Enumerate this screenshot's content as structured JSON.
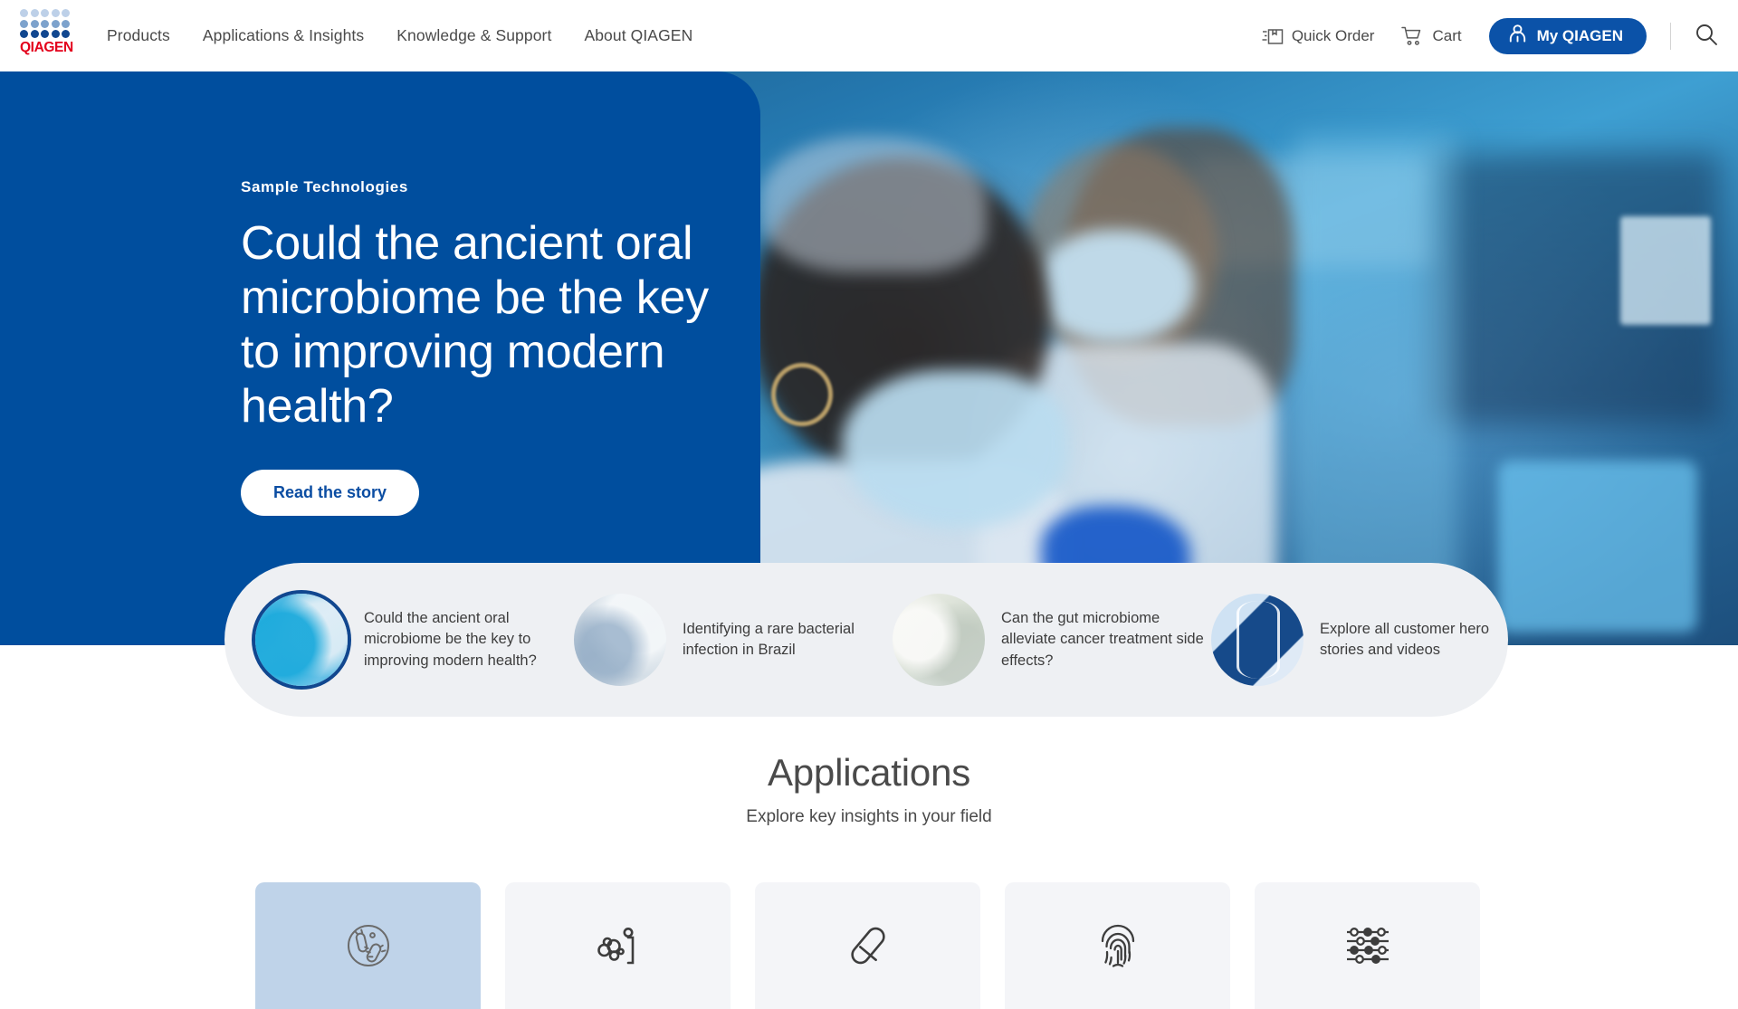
{
  "brand": {
    "logo_word": "QIAGEN",
    "accent_blue": "#004e9e",
    "logo_red": "#e3001b",
    "button_blue": "#0b52a8"
  },
  "header": {
    "nav": [
      {
        "label": "Products"
      },
      {
        "label": "Applications & Insights"
      },
      {
        "label": "Knowledge & Support"
      },
      {
        "label": "About QIAGEN"
      }
    ],
    "quick_order": {
      "label": "Quick Order",
      "icon": "package-box-icon"
    },
    "cart": {
      "label": "Cart",
      "icon": "shopping-cart-icon"
    },
    "my_qiagen": {
      "label": "My QIAGEN",
      "icon": "user-person-icon"
    },
    "search": {
      "icon": "search-icon",
      "label": "Search"
    }
  },
  "hero": {
    "eyebrow": "Sample Technologies",
    "title": "Could the ancient oral microbiome be the key to improving modern health?",
    "cta_label": "Read the story"
  },
  "carousel": {
    "cards": [
      {
        "text": "Could the ancient oral microbiome be the key to improving modern health?",
        "thumb": "scientist-blue-light-photo",
        "active": true
      },
      {
        "text": "Identifying a rare bacterial infection in Brazil",
        "thumb": "lab-technicians-photo",
        "active": false
      },
      {
        "text": "Can the gut microbiome alleviate cancer treatment side effects?",
        "thumb": "researcher-in-lab-photo",
        "active": false
      },
      {
        "text": "Explore all customer hero stories and videos",
        "thumb": "dna-helix-illustration",
        "active": false
      }
    ]
  },
  "applications": {
    "title": "Applications",
    "subtitle": "Explore key insights in your field",
    "tiles": [
      {
        "icon": "microbiology-bacteria-icon",
        "active": true
      },
      {
        "icon": "cell-cluster-icon",
        "active": false
      },
      {
        "icon": "pill-capsule-icon",
        "active": false
      },
      {
        "icon": "fingerprint-icon",
        "active": false
      },
      {
        "icon": "bioinformatics-beads-icon",
        "active": false
      }
    ]
  }
}
